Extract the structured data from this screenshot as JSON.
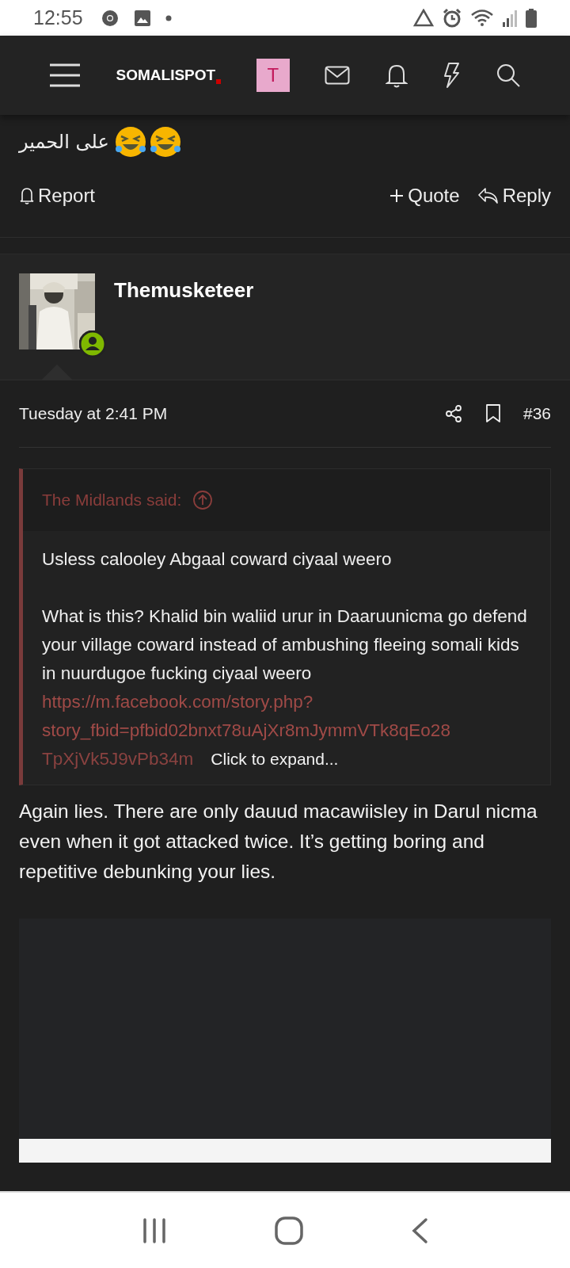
{
  "status_bar": {
    "time": "12:55"
  },
  "header": {
    "logo": "SOMALISPOT",
    "avatar_letter": "T"
  },
  "previous_post": {
    "text": "على الحمير",
    "actions": [
      {
        "label": "Report",
        "kind": "report"
      },
      {
        "label": "Quote",
        "kind": "quote"
      },
      {
        "label": "Reply",
        "kind": "reply"
      }
    ]
  },
  "post": {
    "author": "Themusketeer",
    "online": true,
    "date": "Tuesday at 2:41 PM",
    "number": "#36",
    "quote": {
      "attribution": "The Midlands said:",
      "paragraphs": [
        "Usless calooley Abgaal coward ciyaal weero",
        "What is this? Khalid bin waliid urur in Daaruunicma go defend your village coward instead of ambushing fleeing somali kids in nuurdugoe fucking ciyaal weero"
      ],
      "link_lines": [
        "https://m.facebook.com/story.php?",
        "story_fbid=pfbid02bnxt78uAjXr8mJymmVTk8qEo28",
        "TpXjVk5J9vPb34m"
      ],
      "expand": "Click to expand..."
    },
    "text": "Again lies. There are only dauud macawiisley in Darul nicma even when it got attacked twice. It’s getting boring and repetitive debunking your lies."
  }
}
